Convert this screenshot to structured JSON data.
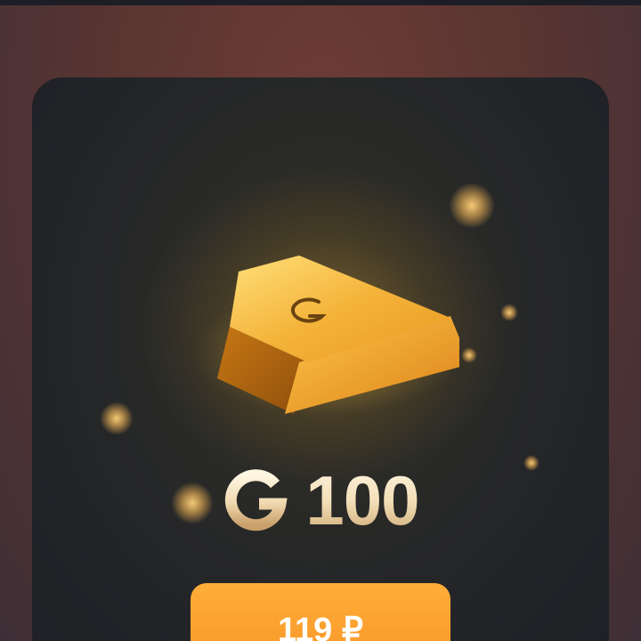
{
  "product": {
    "currency_icon": "g-coin-icon",
    "amount": "100",
    "image": "gold-bar-icon"
  },
  "purchase": {
    "price_label": "119 ₽"
  },
  "colors": {
    "button": "#f79c2c",
    "card_background": "#23252a",
    "gold": "#e8a93a"
  }
}
